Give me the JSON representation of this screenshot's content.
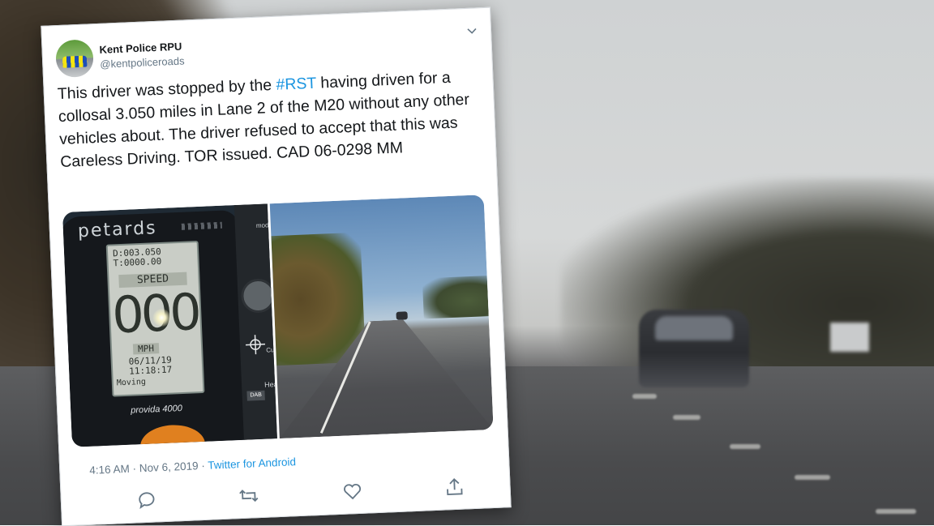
{
  "tweet": {
    "display_name": "Kent Police RPU",
    "handle": "@kentpoliceroads",
    "text_before": "This driver was stopped by the ",
    "hashtag": "#RST",
    "text_after": " having driven for a collosal 3.050 miles in Lane 2 of the M20 without any other vehicles about. The driver refused to accept that this was Careless Driving. TOR issued. CAD 06-0298 MM",
    "timestamp": "4:16 AM · Nov 6, 2019 · ",
    "source": "Twitter for Android",
    "actions": {
      "reply_icon": "reply-icon",
      "retweet_icon": "retweet-icon",
      "like_icon": "like-icon",
      "share_icon": "share-icon"
    },
    "colors": {
      "link": "#1b95e0",
      "text": "#14171a",
      "muted": "#657786"
    }
  },
  "device_photo": {
    "brand": "petards",
    "lcd_distance": "D:003.050",
    "lcd_time": "T:0000.00",
    "lcd_speed_label": "SPEED",
    "lcd_speed": "000",
    "lcd_unit": "MPH",
    "lcd_date": "06/11/19",
    "lcd_clock": "11:18:17",
    "lcd_status": "Moving",
    "model": "provida 4000",
    "panel_mode": "mode",
    "panel_curr": "Curre",
    "panel_hea": "Hea",
    "panel_dab": "DAB"
  }
}
